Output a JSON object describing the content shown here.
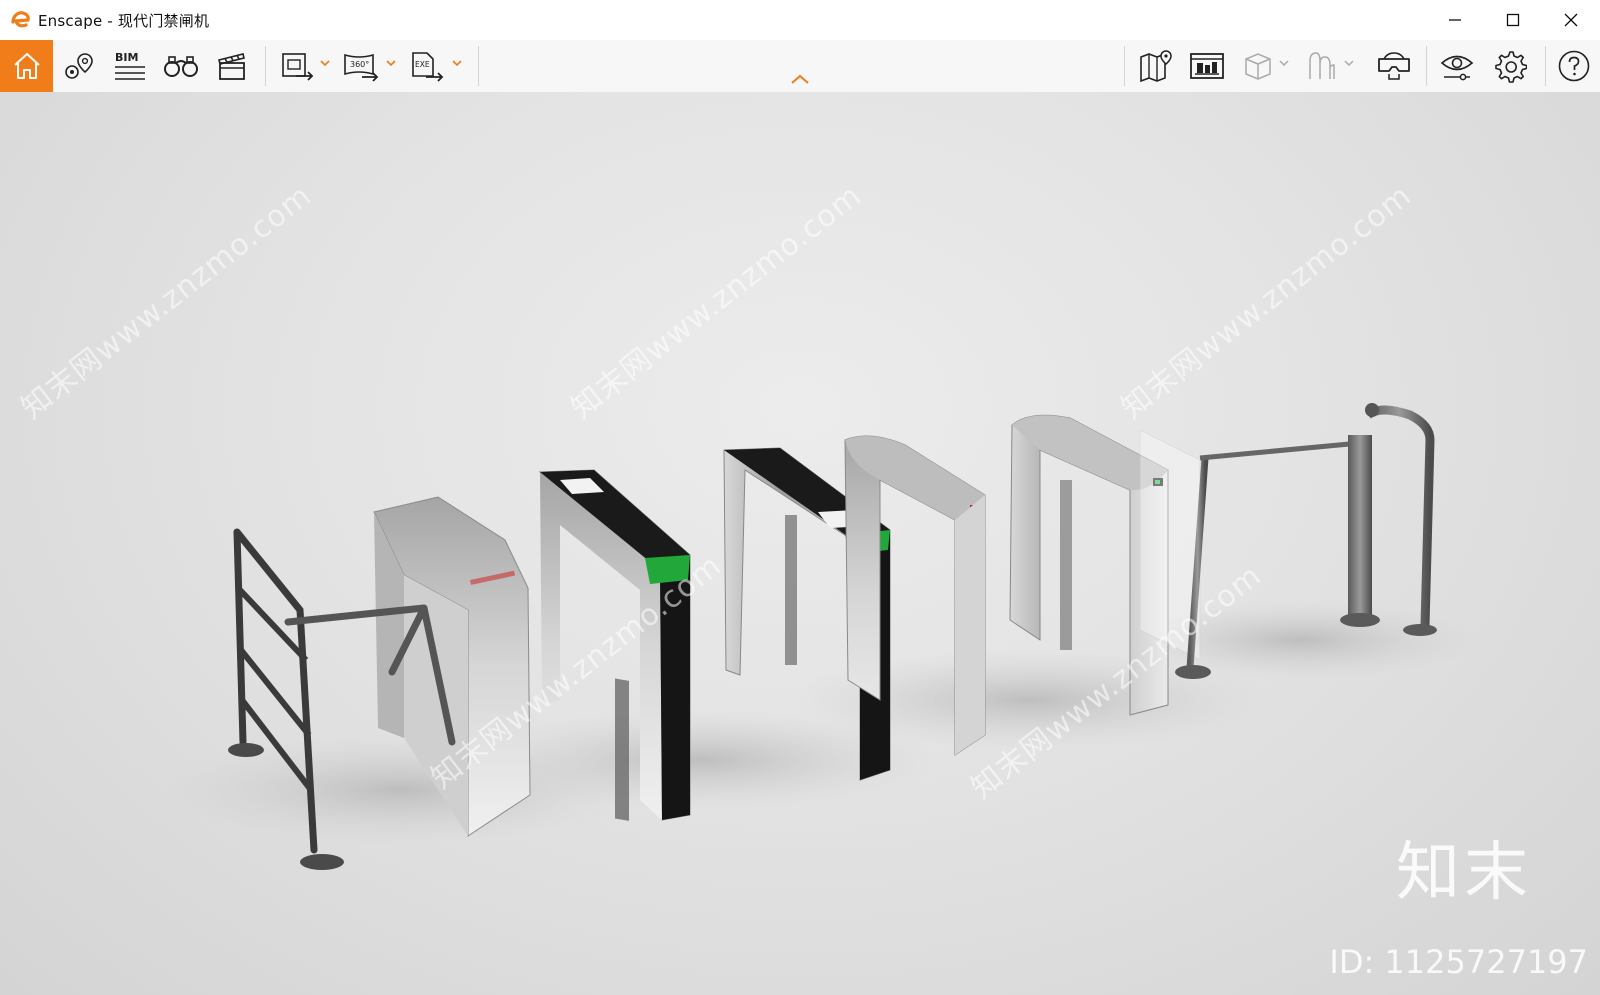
{
  "window": {
    "app_name": "Enscape",
    "title": "Enscape - 现代门禁闸机",
    "controls": [
      "minimize",
      "maximize",
      "close"
    ]
  },
  "toolbar": {
    "left_buttons": [
      {
        "name": "home",
        "icon": "home-icon",
        "active": true
      },
      {
        "name": "views",
        "icon": "location-pin-icon"
      },
      {
        "name": "bim",
        "icon": "bim-icon",
        "label": "BIM"
      },
      {
        "name": "binoculars",
        "icon": "binoculars-icon"
      },
      {
        "name": "video",
        "icon": "clapperboard-icon"
      },
      {
        "name": "screenshot",
        "icon": "export-image-icon",
        "dropdown": true
      },
      {
        "name": "panorama",
        "icon": "panorama-icon",
        "label": "360°",
        "dropdown": true
      },
      {
        "name": "exe",
        "icon": "export-exe-icon",
        "label": "EXE",
        "dropdown": true
      }
    ],
    "right_buttons": [
      {
        "name": "map",
        "icon": "map-icon"
      },
      {
        "name": "web",
        "icon": "web-standalone-icon"
      },
      {
        "name": "box",
        "icon": "cube-icon",
        "dropdown": true,
        "disabled": true
      },
      {
        "name": "atmosphere",
        "icon": "atmosphere-icon",
        "dropdown": true,
        "disabled": true
      },
      {
        "name": "vr",
        "icon": "vr-headset-icon"
      },
      {
        "name": "visual",
        "icon": "eye-icon"
      },
      {
        "name": "settings",
        "icon": "gear-icon"
      },
      {
        "name": "help",
        "icon": "help-icon"
      }
    ],
    "accent_color": "#f07d1a"
  },
  "viewport": {
    "watermark_text": "知末网www.znzmo.com",
    "brand_text": "知末",
    "image_id": "ID: 1125727197"
  }
}
